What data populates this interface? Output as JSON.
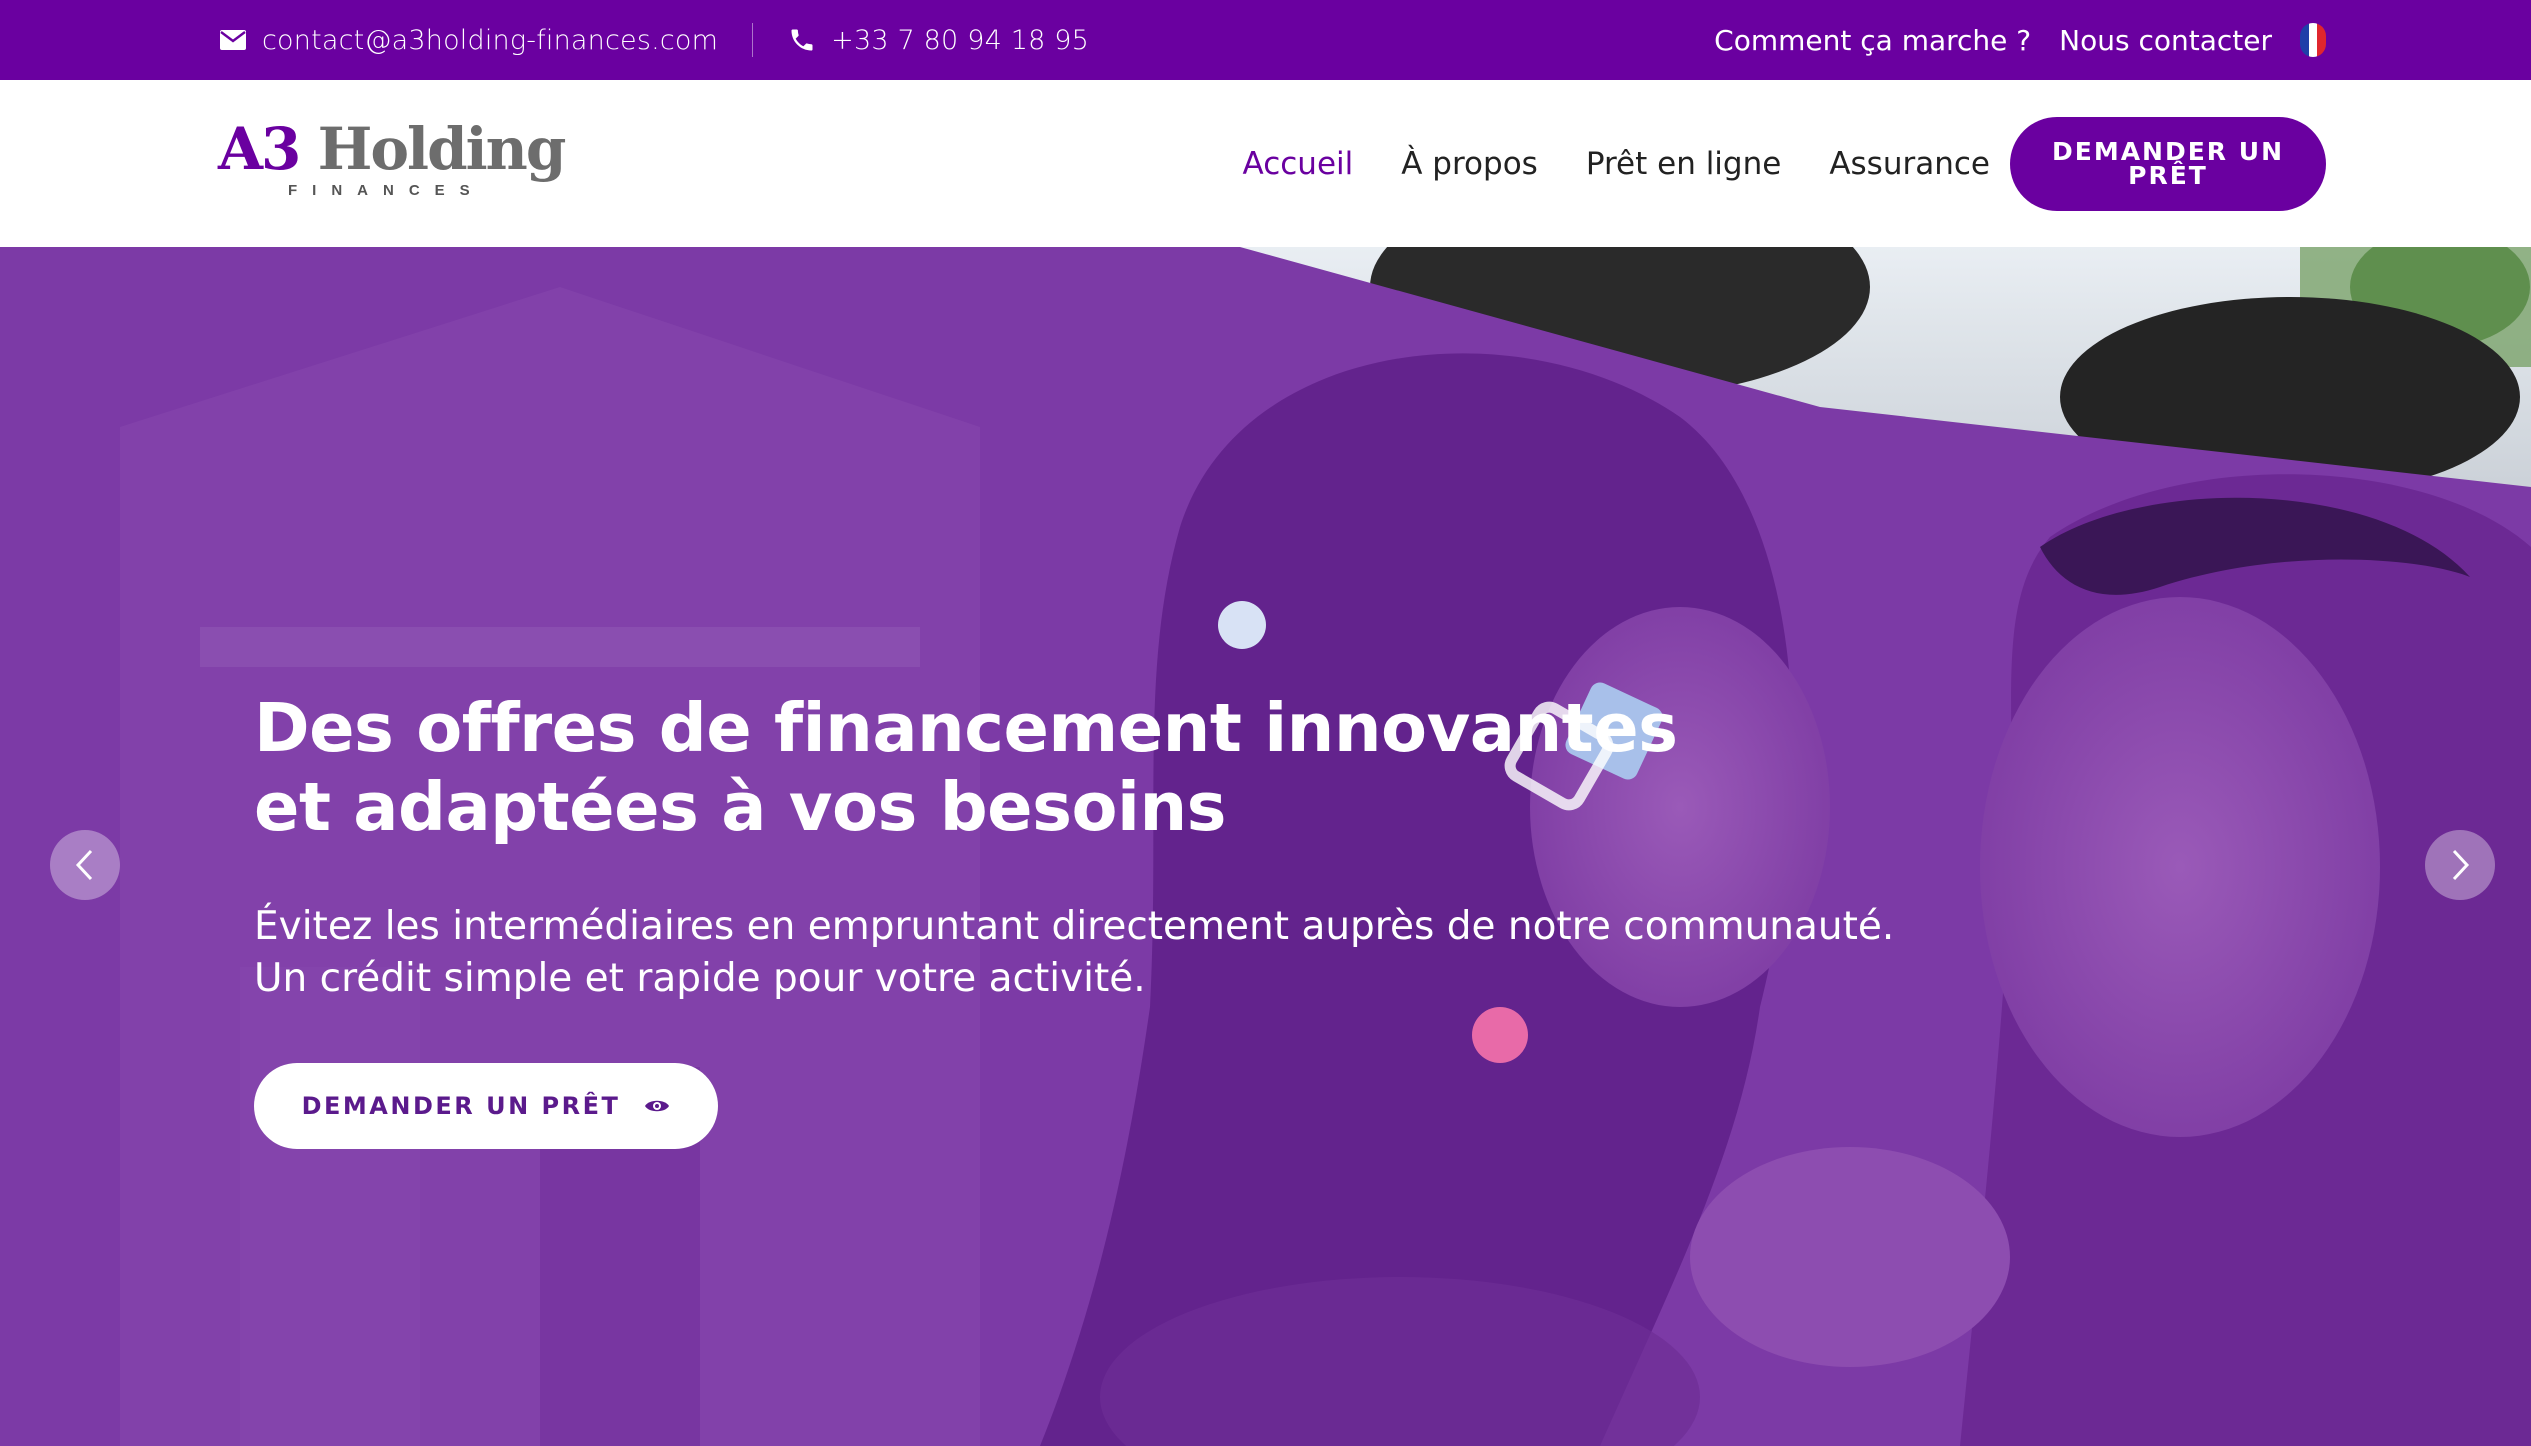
{
  "topbar": {
    "email": "contact@a3holding-finances.com",
    "phone": "+33 7 80 94 18 95",
    "how_it_works": "Comment ça marche ?",
    "contact_us": "Nous contacter",
    "language_flag": "fr"
  },
  "header": {
    "logo": {
      "a3": "A3",
      "holding": "Holding",
      "tagline": "FINANCES"
    },
    "nav": [
      {
        "label": "Accueil",
        "active": true
      },
      {
        "label": "À propos"
      },
      {
        "label": "Prêt en ligne"
      },
      {
        "label": "Assurance"
      }
    ],
    "cta_label": "DEMANDER UN PRÊT"
  },
  "hero": {
    "title_line1": "Des offres de financement innovantes",
    "title_line2": "et adaptées à vos besoins",
    "subtitle_line1": "Évitez les intermédiaires en empruntant directement auprès de notre communauté.",
    "subtitle_line2": "Un crédit simple et rapide pour votre activité.",
    "button_label": "DEMANDER UN PRÊT",
    "prev_icon": "chevron-left-icon",
    "next_icon": "chevron-right-icon"
  },
  "colors": {
    "brand": "#6a00a0",
    "overlay": "#7a36a0",
    "accent_pink": "#e86aa8",
    "accent_blue": "#a8c0ea"
  }
}
